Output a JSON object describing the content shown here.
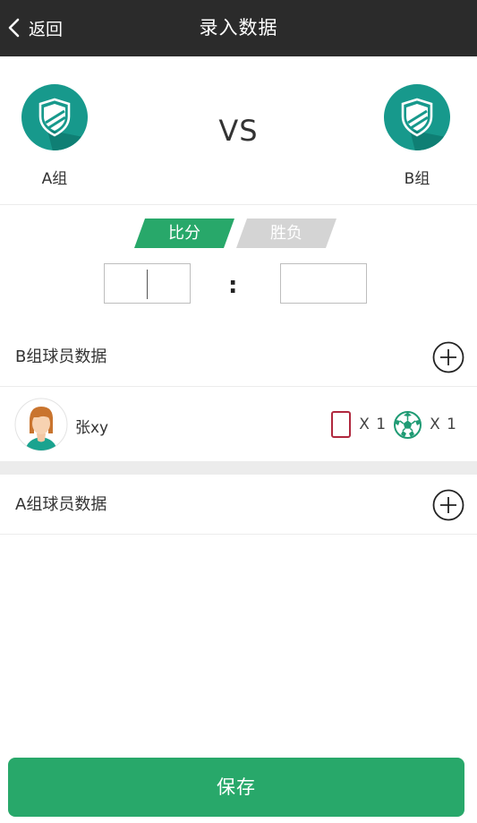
{
  "header": {
    "back_label": "返回",
    "title": "录入数据"
  },
  "match": {
    "team_a": {
      "name": "A组",
      "logo": "shield-logo"
    },
    "team_b": {
      "name": "B组",
      "logo": "shield-logo"
    },
    "vs_label": "VS"
  },
  "tabs": [
    {
      "label": "比分",
      "active": true
    },
    {
      "label": "胜负",
      "active": false
    }
  ],
  "score": {
    "left_value": "",
    "right_value": "",
    "separator": ":"
  },
  "sections": {
    "b_players": {
      "title": "B组球员数据",
      "players": [
        {
          "name": "张xy",
          "red_cards": "X 1",
          "goals": "X 1"
        }
      ]
    },
    "a_players": {
      "title": "A组球员数据",
      "players": []
    }
  },
  "save_label": "保存",
  "colors": {
    "brand_green": "#28a86a",
    "teal_logo": "#17998c",
    "header_bg": "#2b2b2b",
    "red_card": "#b0283e"
  }
}
